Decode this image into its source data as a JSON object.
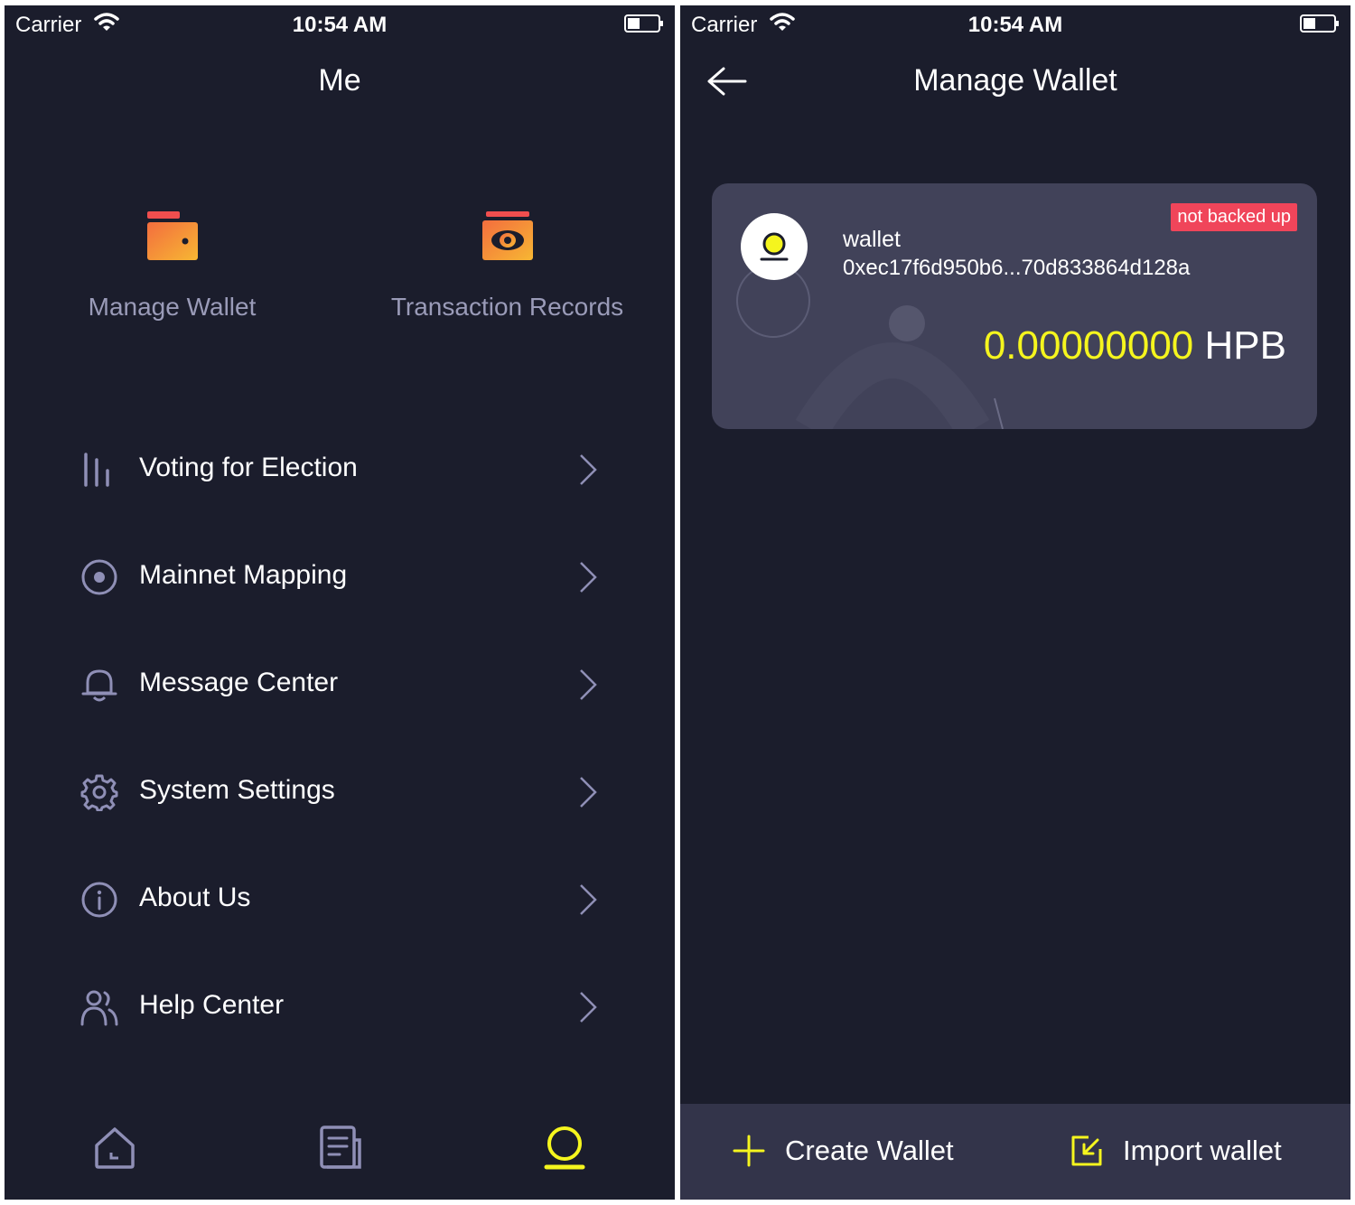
{
  "colors": {
    "background": "#1b1d2c",
    "card": "#414259",
    "accent_yellow": "#f5f51e",
    "badge_red": "#f0455a",
    "muted_text": "#9a9bb8",
    "icon_stroke": "#8f8fb6",
    "wallet_icon_gradient": [
      "#f36d3e",
      "#f7b733"
    ]
  },
  "left": {
    "status": {
      "carrier": "Carrier",
      "time": "10:54 AM"
    },
    "title": "Me",
    "quick_actions": [
      {
        "label": "Manage Wallet",
        "icon": "wallet-icon"
      },
      {
        "label": "Transaction Records",
        "icon": "money-icon"
      }
    ],
    "menu": [
      {
        "label": "Voting for Election",
        "icon": "bars-icon"
      },
      {
        "label": "Mainnet Mapping",
        "icon": "target-icon"
      },
      {
        "label": "Message Center",
        "icon": "bell-icon"
      },
      {
        "label": "System Settings",
        "icon": "gear-icon"
      },
      {
        "label": "About Us",
        "icon": "info-icon"
      },
      {
        "label": "Help Center",
        "icon": "people-icon"
      }
    ],
    "tabs": [
      {
        "icon": "home-icon",
        "active": false
      },
      {
        "icon": "document-icon",
        "active": false
      },
      {
        "icon": "profile-icon",
        "active": true
      }
    ]
  },
  "right": {
    "status": {
      "carrier": "Carrier",
      "time": "10:54 AM"
    },
    "title": "Manage Wallet",
    "wallet": {
      "name": "wallet",
      "address": "0xec17f6d950b6...70d833864d128a",
      "badge": "not backed up",
      "amount": "0.00000000",
      "unit": "HPB"
    },
    "actions": {
      "create": "Create Wallet",
      "import": "Import wallet"
    }
  }
}
